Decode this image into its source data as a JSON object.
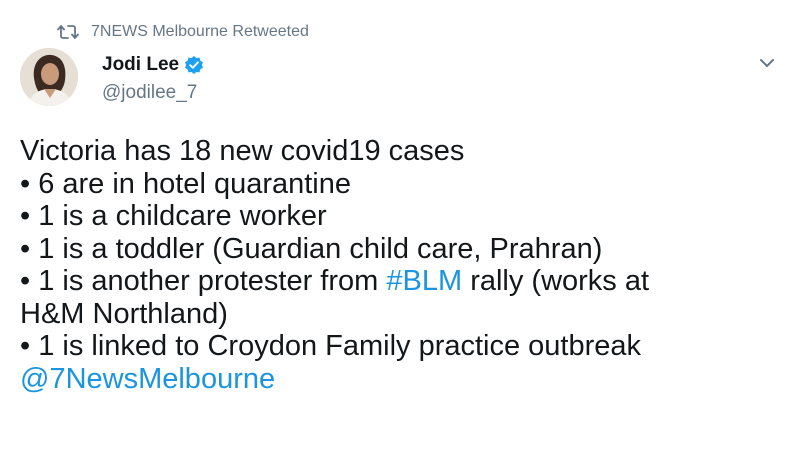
{
  "retweet": {
    "icon": "retweet-icon",
    "text": "7NEWS Melbourne Retweeted"
  },
  "author": {
    "avatar": "avatar",
    "name": "Jodi Lee",
    "verified_icon": "verified-badge-icon",
    "handle": "@jodilee_7"
  },
  "menu": {
    "icon": "chevron-down-icon"
  },
  "tweet": {
    "line1": "Victoria has 18 new covid19 cases",
    "line2": "• 6 are in hotel quarantine",
    "line3": "• 1 is a childcare worker",
    "line4": "• 1 is a toddler (Guardian child care, Prahran)",
    "line5_pre": "• 1 is another protester from ",
    "hashtag": "#BLM",
    "line5_post": " rally (works at",
    "line6": "H&M Northland)",
    "line7": "• 1 is linked to Croydon Family practice outbreak",
    "mention": "@7NewsMelbourne"
  },
  "colors": {
    "link": "#1b95e0",
    "muted": "#657786",
    "text": "#14171a",
    "verified": "#1da1f2"
  }
}
